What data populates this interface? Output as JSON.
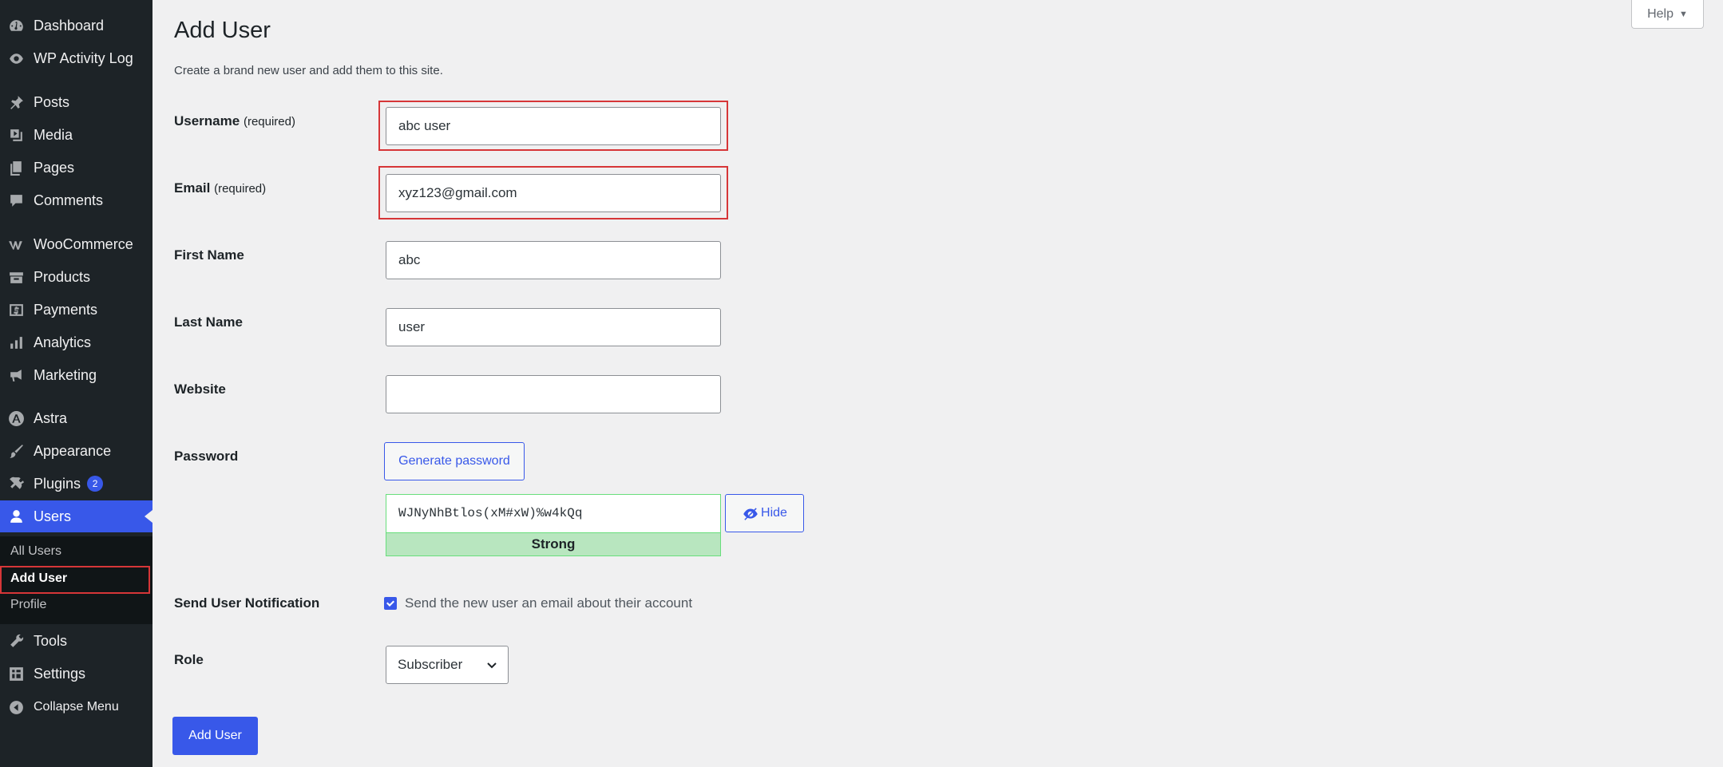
{
  "sidebar": {
    "items": [
      {
        "label": "Dashboard",
        "icon": "dashboard-icon"
      },
      {
        "label": "WP Activity Log",
        "icon": "activity-log-icon"
      },
      {
        "label": "Posts",
        "icon": "pin-icon"
      },
      {
        "label": "Media",
        "icon": "media-icon"
      },
      {
        "label": "Pages",
        "icon": "pages-icon"
      },
      {
        "label": "Comments",
        "icon": "comment-icon"
      },
      {
        "label": "WooCommerce",
        "icon": "woocommerce-icon"
      },
      {
        "label": "Products",
        "icon": "archive-icon"
      },
      {
        "label": "Payments",
        "icon": "dollar-icon"
      },
      {
        "label": "Analytics",
        "icon": "bar-chart-icon"
      },
      {
        "label": "Marketing",
        "icon": "megaphone-icon"
      },
      {
        "label": "Astra",
        "icon": "astra-icon"
      },
      {
        "label": "Appearance",
        "icon": "brush-icon"
      },
      {
        "label": "Plugins",
        "icon": "plug-icon",
        "badge": "2"
      },
      {
        "label": "Users",
        "icon": "user-icon"
      },
      {
        "label": "Tools",
        "icon": "wrench-icon"
      },
      {
        "label": "Settings",
        "icon": "settings-icon"
      },
      {
        "label": "Collapse Menu",
        "icon": "collapse-icon"
      }
    ],
    "submenu": [
      "All Users",
      "Add User",
      "Profile"
    ]
  },
  "help": {
    "label": "Help",
    "arrow": "▼"
  },
  "page": {
    "title": "Add User",
    "description": "Create a brand new user and add them to this site."
  },
  "form": {
    "username": {
      "label": "Username",
      "required": "(required)",
      "value": "abc user"
    },
    "email": {
      "label": "Email",
      "required": "(required)",
      "value": "xyz123@gmail.com"
    },
    "first_name": {
      "label": "First Name",
      "value": "abc"
    },
    "last_name": {
      "label": "Last Name",
      "value": "user"
    },
    "website": {
      "label": "Website",
      "value": ""
    },
    "password": {
      "label": "Password",
      "generate_label": "Generate password",
      "value": "WJNyNhBtlos(xM#xW)%w4kQq",
      "strength": "Strong",
      "hide_label": "Hide"
    },
    "notification": {
      "label": "Send User Notification",
      "checkbox_label": "Send the new user an email about their account",
      "checked": true
    },
    "role": {
      "label": "Role",
      "value": "Subscriber"
    },
    "submit_label": "Add User"
  },
  "colors": {
    "accent": "#3858e9",
    "sidebar": "#1d2327",
    "highlight": "#d63638",
    "strength": "#b8e6bf"
  }
}
